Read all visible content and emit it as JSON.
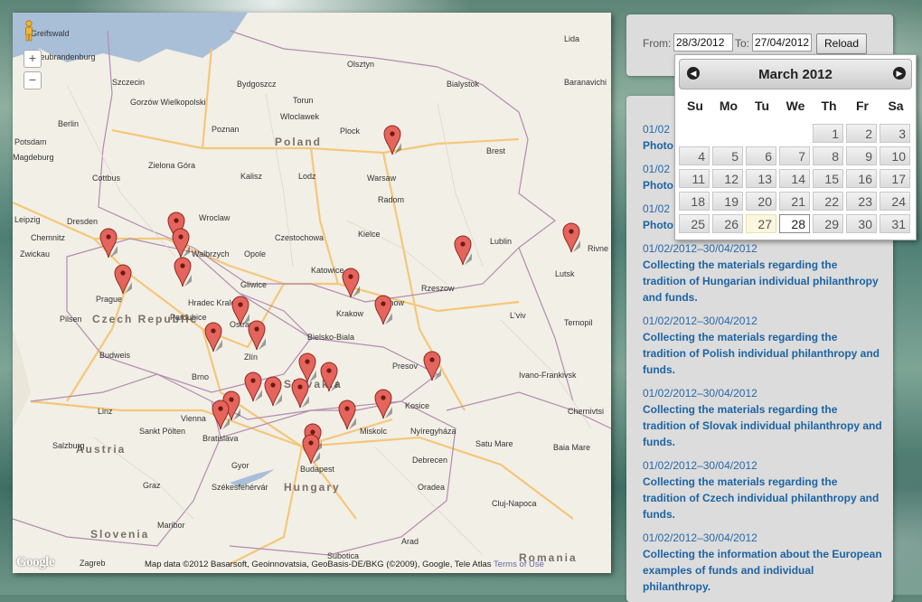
{
  "map": {
    "countries": [
      {
        "name": "Poland"
      },
      {
        "name": "Czech Republic"
      },
      {
        "name": "Slovakia"
      },
      {
        "name": "Austria"
      },
      {
        "name": "Hungary"
      },
      {
        "name": "Slovenia"
      },
      {
        "name": "Romania"
      }
    ],
    "cities": [
      "Greifswald",
      "Neubrandenburg",
      "Szczecin",
      "Berlin",
      "Potsdam",
      "Magdeburg",
      "Gorzów Wielkopolski",
      "Bydgoszcz",
      "Olsztyn",
      "Lida",
      "Torun",
      "Wloclawek",
      "Poznan",
      "Plock",
      "Bialystok",
      "Baranavichi",
      "Cottbus",
      "Zielona Góra",
      "Warsaw",
      "Leipzig",
      "Dresden",
      "Wroclaw",
      "Kalisz",
      "Lodz",
      "Radom",
      "Brest",
      "Chemnitz",
      "Zwickau",
      "Walbrzych",
      "Opole",
      "Czestochowa",
      "Kielce",
      "Lublin",
      "Lutsk",
      "Rivne",
      "Prague",
      "Hradec Kralove",
      "Gliwice",
      "Katowice",
      "Krakow",
      "Tarnow",
      "Rzeszow",
      "Pardubice",
      "Ostrava",
      "Bielsko-Biala",
      "L'viv",
      "Ternopil",
      "Pilsen",
      "Zlín",
      "Brno",
      "Budweis",
      "Presov",
      "Kosice",
      "Ivano-Frankivsk",
      "Linz",
      "Vienna",
      "Bratislava",
      "Miskolc",
      "Nyíregyháza",
      "Chernivtsi",
      "Salzburg",
      "Sankt Pölten",
      "Graz",
      "Gyor",
      "Budapest",
      "Debrecen",
      "Satu Mare",
      "Baia Mare",
      "Székesfehérvár",
      "Oradea",
      "Maribor",
      "Cluj-Napoca",
      "Zagreb",
      "Subotica",
      "Arad"
    ],
    "zoom_in": "+",
    "zoom_out": "−",
    "attribution": "Map data ©2012 Basarsoft, Geoinnovatsia, GeoBasis-DE/BKG (©2009), Google, Tele Atlas",
    "terms": "Terms of Use",
    "logo": "Google",
    "marker_color": "#e5645b"
  },
  "filter": {
    "from_label": "From:",
    "from_value": "28/3/2012",
    "to_label": "To:",
    "to_value": "27/04/2012",
    "reload_label": "Reload"
  },
  "datepicker": {
    "month_title": "March 2012",
    "prev_icon": "◀",
    "next_icon": "▶",
    "weekdays": [
      "Su",
      "Mo",
      "Tu",
      "We",
      "Th",
      "Fr",
      "Sa"
    ],
    "days": [
      1,
      2,
      3,
      4,
      5,
      6,
      7,
      8,
      9,
      10,
      11,
      12,
      13,
      14,
      15,
      16,
      17,
      18,
      19,
      20,
      21,
      22,
      23,
      24,
      25,
      26,
      27,
      28,
      29,
      30,
      31
    ],
    "today": 27,
    "selected": 28
  },
  "list": {
    "partial_items": [
      {
        "date": "01/02",
        "title": "Photo"
      },
      {
        "date": "01/02",
        "title": "Photo"
      },
      {
        "date": "01/02",
        "title": "Photo"
      }
    ],
    "items": [
      {
        "date": "01/02/2012–30/04/2012",
        "title": [
          "Collecting the materials regarding the",
          "tradition of Hungarian individual philanthropy",
          "and funds."
        ]
      },
      {
        "date": "01/02/2012–30/04/2012",
        "title": [
          "Collecting the materials regarding the",
          "tradition of Polish individual philanthropy and",
          "funds."
        ]
      },
      {
        "date": "01/02/2012–30/04/2012",
        "title": [
          "Collecting the materials regarding the",
          "tradition of Slovak individual philanthropy and",
          "funds."
        ]
      },
      {
        "date": "01/02/2012–30/04/2012",
        "title": [
          "Collecting the materials regarding the",
          "tradition of Czech individual philanthropy and",
          "funds."
        ]
      },
      {
        "date": "01/02/2012–30/04/2012",
        "title": [
          "Collecting the information about the European",
          "examples of funds and individual",
          "philanthropy."
        ]
      }
    ]
  }
}
